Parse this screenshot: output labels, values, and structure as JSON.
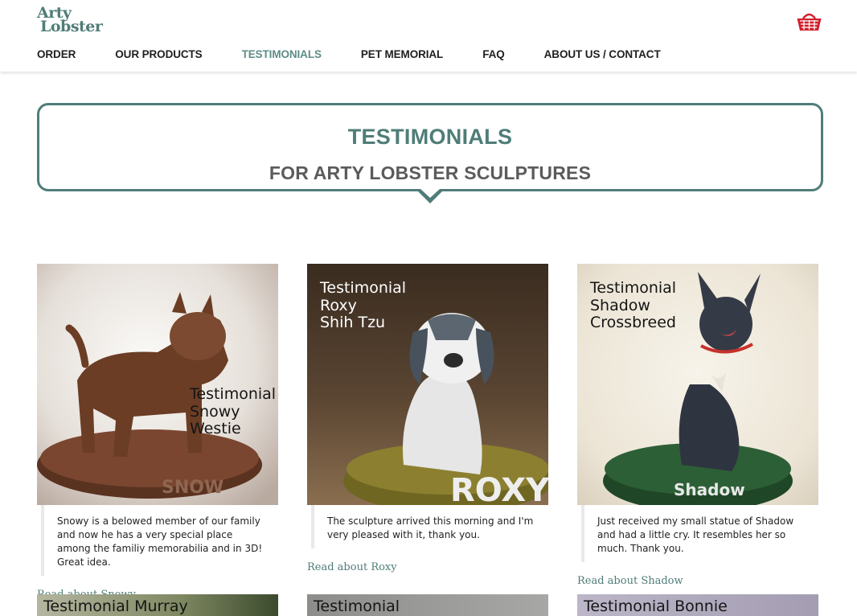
{
  "brand": {
    "logo_line1": "Arty",
    "logo_line2": "Lobster"
  },
  "nav": {
    "items": [
      "ORDER",
      "OUR PRODUCTS",
      "TESTIMONIALS",
      "PET MEMORIAL",
      "FAQ",
      "ABOUT US / CONTACT"
    ],
    "active": "TESTIMONIALS"
  },
  "banner": {
    "title": "TESTIMONIALS",
    "subtitle": "FOR ARTY LOBSTER SCULPTURES"
  },
  "cards": [
    {
      "caption": [
        "Testimonial",
        "Snowy",
        "Westie"
      ],
      "quote": "Snowy is a belowed member of our family and now he has a very special place among the familiy memorabilia and in 3D! Great idea.",
      "link": "Read about Snowy",
      "base_text": "SNOW"
    },
    {
      "caption": [
        "Testimonial",
        "Roxy",
        "Shih Tzu"
      ],
      "quote": "The sculpture arrived this morning and I'm very pleased with it, thank you.",
      "link": "Read about Roxy",
      "base_text": "ROXY"
    },
    {
      "caption": [
        "Testimonial",
        "Shadow",
        "Crossbreed"
      ],
      "quote": "Just received my small statue of Shadow and had a little cry. It resembles her so much. Thank you.",
      "link": "Read about Shadow",
      "base_text": "Shadow"
    }
  ],
  "next_row": [
    "Testimonial Murray",
    "Testimonial",
    "Testimonial Bonnie"
  ],
  "colors": {
    "accent": "#4f7d78",
    "cart": "#d0202e"
  },
  "icons": {
    "cart": "basket-icon"
  }
}
